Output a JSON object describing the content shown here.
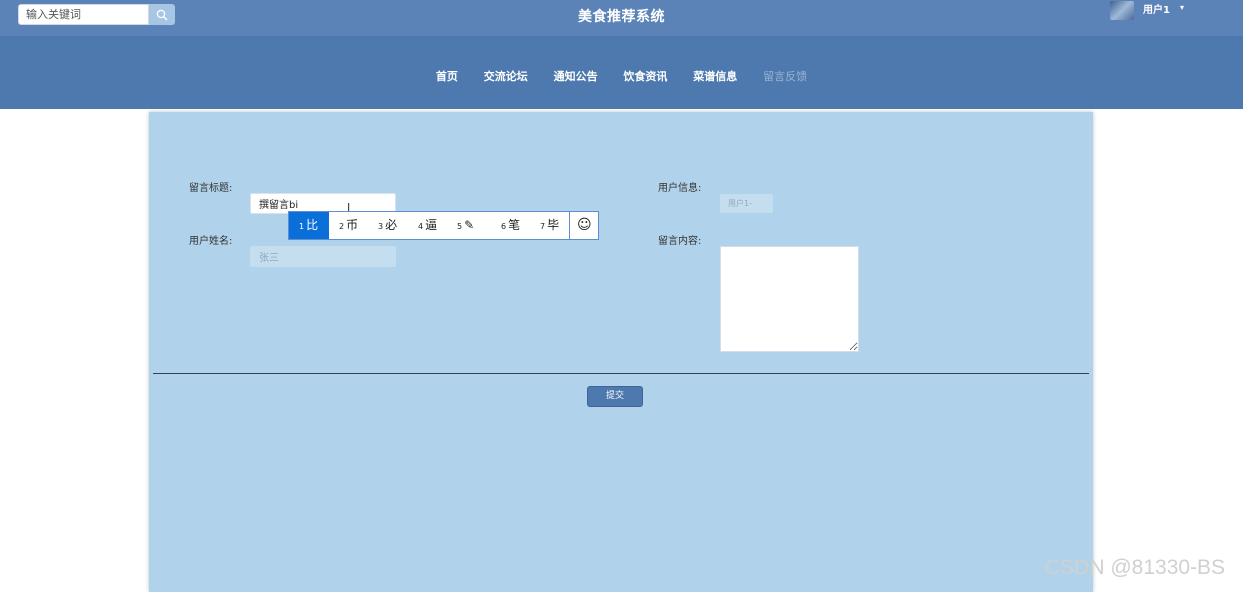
{
  "header": {
    "search_placeholder": "输入关键词",
    "site_title": "美食推荐系统",
    "user": {
      "name": "用户1",
      "caret": "▾"
    }
  },
  "nav": {
    "items": [
      {
        "label": "首页"
      },
      {
        "label": "交流论坛"
      },
      {
        "label": "通知公告"
      },
      {
        "label": "饮食资讯"
      },
      {
        "label": "菜谱信息"
      },
      {
        "label": "留言反馈"
      }
    ],
    "active_index": 5
  },
  "form": {
    "title_label": "留言标题:",
    "title_value": "撰留言bi",
    "name_label": "用户姓名:",
    "name_value": "张三",
    "info_label": "用户信息:",
    "info_value": "用户1-",
    "content_label": "留言内容:",
    "content_value": "",
    "submit_label": "提交"
  },
  "ime": {
    "candidates": [
      {
        "num": "1",
        "text": "比"
      },
      {
        "num": "2",
        "text": "币"
      },
      {
        "num": "3",
        "text": "必"
      },
      {
        "num": "4",
        "text": "逼"
      },
      {
        "num": "5",
        "text": "✎"
      },
      {
        "num": "6",
        "text": "笔"
      },
      {
        "num": "7",
        "text": "毕"
      }
    ],
    "selected_index": 0,
    "emoji_glyph": "☺",
    "cursor_glyph": "I"
  },
  "watermark": "CSDN @81330-BS",
  "colors": {
    "topbar": "#5b83b8",
    "navbar": "#4d79ae",
    "panel": "#b0d3eb",
    "ime_highlight": "#0a6fd8"
  }
}
